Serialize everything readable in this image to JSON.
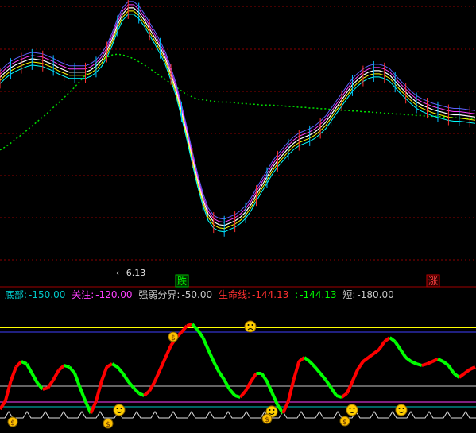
{
  "chart_data": [
    {
      "type": "line",
      "title": "",
      "annotations": {
        "low_price": "← 6.13",
        "signal_down": "跌",
        "signal_up": "涨"
      },
      "series": [
        {
          "color": "#00e000",
          "values": [
            148,
            152,
            157,
            163,
            168,
            174,
            180,
            186,
            192,
            198,
            205,
            211,
            218,
            225,
            232,
            240,
            248,
            256,
            262,
            268,
            272,
            275,
            276,
            275,
            273,
            270,
            266,
            262,
            257,
            252,
            247,
            242,
            237,
            232,
            227,
            222,
            219,
            216,
            215,
            214,
            213,
            212,
            212,
            212,
            211,
            210,
            210,
            209,
            209,
            208,
            208,
            208,
            207,
            207,
            206,
            206,
            205,
            205,
            204,
            204,
            203,
            203,
            202,
            202,
            201,
            201,
            200,
            200,
            199,
            199,
            198,
            198,
            197,
            197,
            196,
            196,
            195,
            195,
            194,
            194,
            193,
            193,
            193,
            192,
            192,
            191,
            191,
            190,
            190,
            190
          ]
        },
        {
          "color": "#ffffff",
          "values": [
            245,
            252,
            258,
            262,
            265,
            268,
            270,
            269,
            268,
            265,
            262,
            258,
            255,
            252,
            252,
            252,
            252,
            255,
            260,
            268,
            280,
            296,
            315,
            330,
            338,
            338,
            332,
            322,
            310,
            298,
            285,
            270,
            250,
            228,
            200,
            170,
            138,
            108,
            82,
            62,
            52,
            48,
            47,
            50,
            53,
            58,
            65,
            75,
            88,
            100,
            112,
            124,
            134,
            142,
            150,
            157,
            162,
            165,
            168,
            172,
            178,
            185,
            195,
            205,
            215,
            225,
            235,
            242,
            248,
            252,
            254,
            254,
            252,
            248,
            240,
            232,
            225,
            218,
            212,
            208,
            205,
            202,
            200,
            198,
            196,
            195,
            195,
            194,
            193,
            192
          ]
        }
      ],
      "ylim": [
        0,
        340
      ]
    },
    {
      "type": "line",
      "title": "",
      "legend": [
        {
          "label": "底部:",
          "value": "-150.00",
          "color": "#00c8c8"
        },
        {
          "label": "关注:",
          "value": "-120.00",
          "color": "#ff40ff"
        },
        {
          "label": "强弱分界:",
          "value": "-50.00",
          "color": "#c8c8c8"
        },
        {
          "label": "生命线:",
          "value": "-144.13",
          "color": "#ff3030"
        },
        {
          "label": ":",
          "value": "-144.13",
          "color": "#00ff00"
        },
        {
          "label": "短:",
          "value": "-180.00",
          "color": "#c8c8c8"
        }
      ],
      "series": [
        {
          "color": "#ff0000 / #00ff00 (rising / falling)",
          "values": [
            515,
            505,
            480,
            462,
            455,
            458,
            470,
            482,
            490,
            488,
            478,
            466,
            460,
            462,
            470,
            488,
            505,
            520,
            505,
            480,
            462,
            458,
            462,
            470,
            480,
            488,
            495,
            498,
            492,
            480,
            465,
            450,
            435,
            425,
            418,
            410,
            408,
            415,
            425,
            440,
            455,
            468,
            478,
            490,
            498,
            500,
            492,
            480,
            470,
            470,
            480,
            495,
            510,
            520,
            505,
            478,
            455,
            450,
            455,
            462,
            470,
            478,
            488,
            498,
            500,
            495,
            480,
            465,
            455,
            450,
            445,
            440,
            430,
            425,
            430,
            440,
            450,
            455,
            458,
            460,
            458,
            455,
            452,
            455,
            460,
            470,
            475,
            470,
            465,
            462
          ]
        }
      ],
      "horizontal_lines": [
        {
          "value": -150,
          "color": "#00c8c8"
        },
        {
          "value": -120,
          "color": "#ff40ff"
        },
        {
          "value": -50,
          "color": "#c8c8c8"
        },
        {
          "value": 0,
          "color": "#ffff00"
        }
      ]
    }
  ]
}
